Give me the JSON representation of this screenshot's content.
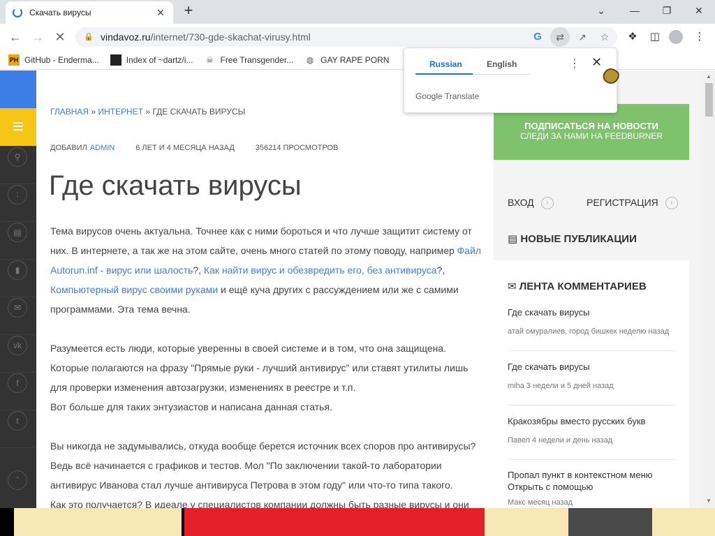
{
  "tab": {
    "title": "Скачать вирусы",
    "close": "✕"
  },
  "new_tab": "+",
  "window_controls": {
    "minimize": "⌄",
    "min2": "—",
    "restore": "❐",
    "close": "✕"
  },
  "nav": {
    "back": "←",
    "forward": "→",
    "stop": "✕"
  },
  "address": {
    "host": "vindavoz.ru",
    "path": "/internet/730-gde-skachat-virusy.html"
  },
  "bookmarks": [
    {
      "icon": "PH",
      "label": "GitHub - Enderma..."
    },
    {
      "icon": "",
      "label": "Index of ~dartz/i..."
    },
    {
      "icon": "☠",
      "label": "Free Transgender..."
    },
    {
      "icon": "◍",
      "label": "GAY RAPE PORN"
    }
  ],
  "translate_popup": {
    "tab_source": "Russian",
    "tab_target": "English",
    "brand": "Google Translate",
    "more": "⋮",
    "close": "✕"
  },
  "page": {
    "breadcrumb": {
      "home": "ГЛАВНАЯ",
      "sep1": "»",
      "section": "ИНТЕРНЕТ",
      "sep2": "»",
      "current": "ГДЕ СКАЧАТЬ ВИРУСЫ"
    },
    "meta": {
      "added_by": "ДОБАВИЛ",
      "author": "ADMIN",
      "age": "6 ЛЕТ И 4 МЕСЯЦА НАЗАД",
      "views": "356214 ПРОСМОТРОВ"
    },
    "title": "Где скачать вирусы",
    "p1_a": "Тема вирусов очень актуальна. Точнее как с ними бороться и что лучше защитит систему от них. В интернете, а так же на этом сайте, очень много статей по этому поводу, например ",
    "p1_link1": "Файл Autorun.inf - вирус или шалость",
    "p1_b": "?, ",
    "p1_link2": "Как найти вирус и обезвредить его, без антивируса",
    "p1_c": "?, ",
    "p1_link3": "Компьютерный вирус своими руками",
    "p1_d": " и ещё куча других с рассуждением или же с самими программами. Эта тема вечна.",
    "p2_l1": "Разумеется есть люди, которые уверенны в своей системе и в том, что она защищена.",
    "p2_l2": "Которые полагаются на фразу \"Прямые руки - лучший антивирус\" или ставят утилиты лишь",
    "p2_l3": "для проверки изменения автозагрузки, изменениях в реестре и т.п.",
    "p2_l4": "Вот больше для таких энтузиастов и написана данная статья.",
    "p3_l1": "Вы никогда не задумывались, откуда вообще берется источник всех споров про антивирусы?",
    "p3_l2": "Ведь всё начинается с графиков и тестов. Мол \"По заключении такой-то лаборатории",
    "p3_l3": "антивирус Иванова стал лучше антивируса Петрова в этом году\" или что-то типа такого.",
    "p3_l4": "Как это получается? В идеале у специалистов компании должны быть разные вирусы и они"
  },
  "sidebar": {
    "subscribe_title": "ПОДПИСАТЬСЯ НА НОВОСТИ",
    "subscribe_sub": "СЛЕДИ ЗА НАМИ НА FEEDBURNER",
    "login": "ВХОД",
    "register": "РЕГИСТРАЦИЯ",
    "new_pubs": "НОВЫЕ ПУБЛИКАЦИИ",
    "comments_feed": "ЛЕНТА КОММЕНТАРИЕВ",
    "comments": [
      {
        "title": "Где скачать вирусы",
        "meta": "атай омуралиев, город бишкек неделю назад"
      },
      {
        "title": "Где скачать вирусы",
        "meta": "miha 3 недели и 5 дней назад"
      },
      {
        "title": "Кракозябры вместо русских букв",
        "meta": "Павел 4 недели и день назад"
      },
      {
        "title": "Пропал пункт в контекстном меню Открыть с помощью",
        "meta": "Макс месяц назад"
      }
    ]
  },
  "colors": {
    "accent": "#3d7ee6",
    "menu_yellow": "#f5c518",
    "subscribe_green": "#7ec26b",
    "chrome_blue": "#1a73e8"
  }
}
